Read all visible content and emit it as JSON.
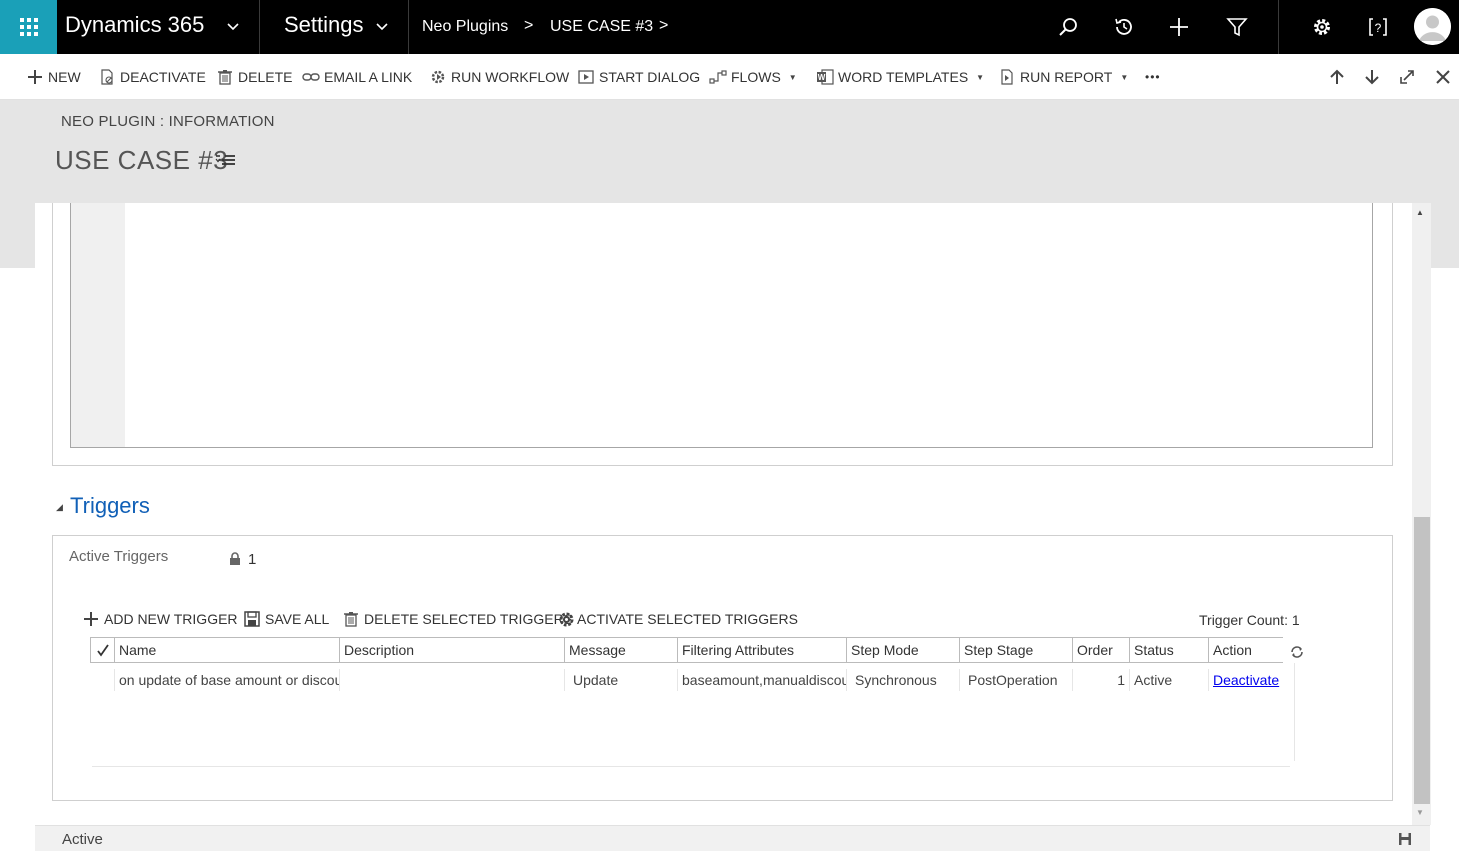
{
  "topnav": {
    "brand": "Dynamics 365",
    "area": "Settings",
    "breadcrumb": [
      "Neo Plugins",
      "USE CASE #3"
    ],
    "arrow": ">",
    "icons": [
      "search-icon",
      "history-icon",
      "plus-icon",
      "filter-icon",
      "gear-icon",
      "help-icon",
      "user-avatar-icon"
    ]
  },
  "commands": {
    "new": "NEW",
    "deactivate": "DEACTIVATE",
    "delete": "DELETE",
    "email_link": "EMAIL A LINK",
    "run_workflow": "RUN WORKFLOW",
    "start_dialog": "START DIALOG",
    "flows": "FLOWS",
    "word_templates": "WORD TEMPLATES",
    "run_report": "RUN REPORT",
    "more": "•••"
  },
  "header": {
    "entity_label": "NEO PLUGIN : INFORMATION",
    "record_title": "USE CASE #3"
  },
  "triggers": {
    "section_title": "Triggers",
    "active_label": "Active Triggers",
    "active_value": "1",
    "add_new": "ADD NEW TRIGGER",
    "save_all": "SAVE ALL",
    "delete_selected": "DELETE SELECTED TRIGGERS",
    "activate_selected": "ACTIVATE SELECTED TRIGGERS",
    "trigger_count": "Trigger Count: 1",
    "columns": [
      "Name",
      "Description",
      "Message",
      "Filtering Attributes",
      "Step Mode",
      "Step Stage",
      "Order",
      "Status",
      "Action"
    ],
    "rows": [
      {
        "name": "on update of base amount or discount",
        "description": "",
        "message": "Update",
        "filtering_attributes": "baseamount,manualdiscount",
        "step_mode": "Synchronous",
        "step_stage": "PostOperation",
        "order": "1",
        "status": "Active",
        "action": "Deactivate"
      }
    ]
  },
  "footer": {
    "status": "Active"
  },
  "colors": {
    "accent": "#1aa0b8",
    "nav_bg": "#000000",
    "link": "#1160b7",
    "header_bg": "#e5e5e5"
  }
}
